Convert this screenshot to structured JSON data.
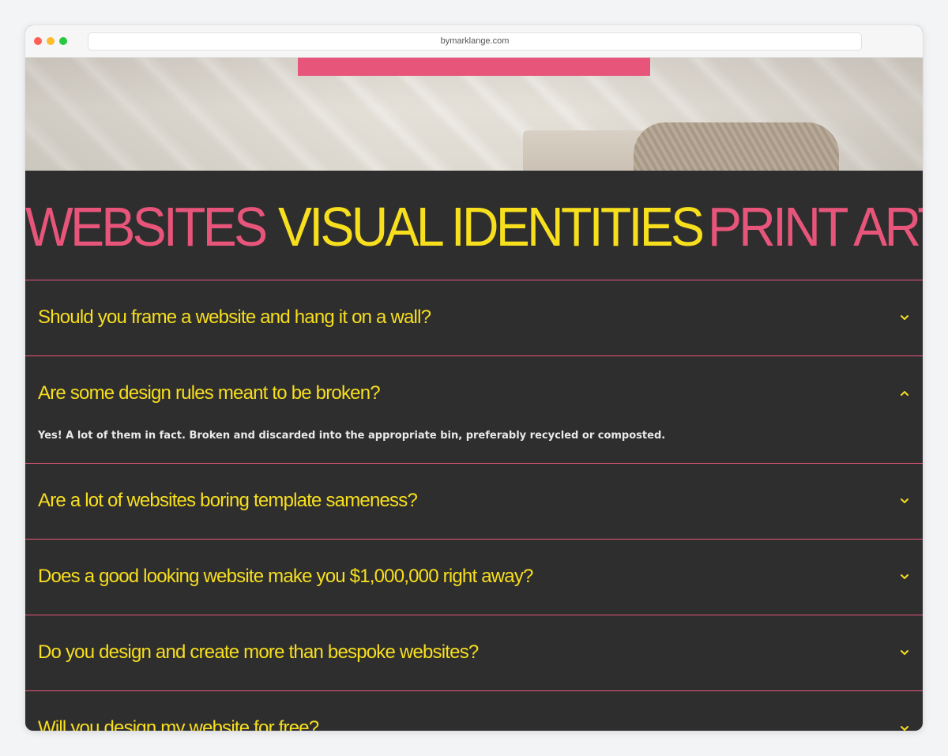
{
  "browser": {
    "url": "bymarklange.com"
  },
  "marquee": {
    "words": [
      "WEBSITES",
      "VISUAL IDENTITIES",
      "PRINT ART"
    ]
  },
  "faq": {
    "items": [
      {
        "question": "Should you frame a website and hang it on a wall?",
        "expanded": false,
        "answer": ""
      },
      {
        "question": "Are some design rules meant to be broken?",
        "expanded": true,
        "answer": "Yes! A lot of them in fact. Broken and discarded into the appropriate bin, preferably recycled or composted."
      },
      {
        "question": "Are a lot of websites boring template sameness?",
        "expanded": false,
        "answer": ""
      },
      {
        "question": "Does a good looking website make you $1,000,000 right away?",
        "expanded": false,
        "answer": ""
      },
      {
        "question": "Do you design and create more than bespoke websites?",
        "expanded": false,
        "answer": ""
      },
      {
        "question": "Will you design my website for free?",
        "expanded": false,
        "answer": ""
      }
    ]
  },
  "colors": {
    "background": "#2f2e2f",
    "accent_pink": "#e8557a",
    "accent_yellow": "#f7df1e",
    "answer_text": "#eaeaea"
  },
  "icons": {
    "collapsed": "chevron-down-icon",
    "expanded": "chevron-up-icon"
  }
}
